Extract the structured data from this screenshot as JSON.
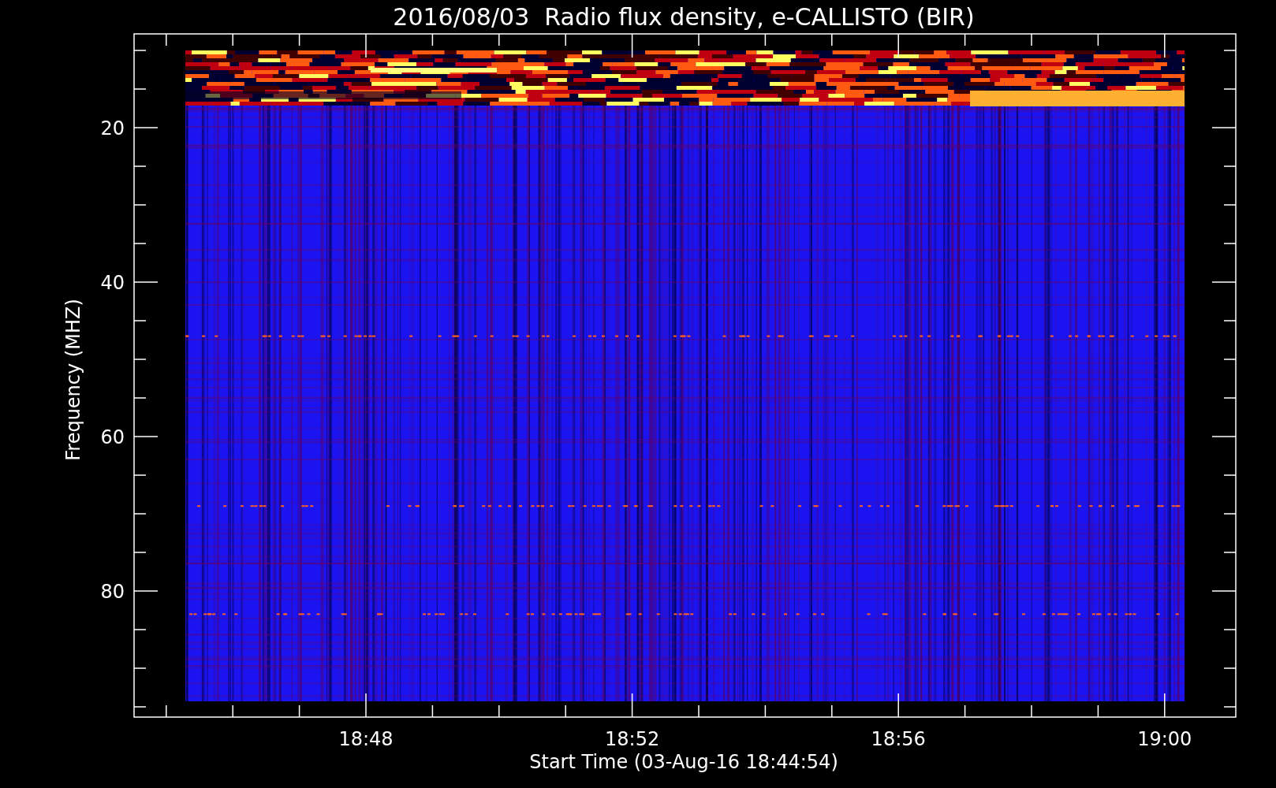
{
  "title": "2016/08/03  Radio flux density, e-CALLISTO (BIR)",
  "y_axis": {
    "label": "Frequency (MHZ)",
    "ticks": [
      "20",
      "40",
      "60",
      "80"
    ]
  },
  "x_axis": {
    "label": "Start Time (03-Aug-16 18:44:54)",
    "ticks": [
      "18:48",
      "18:52",
      "18:56",
      "19:00"
    ]
  }
}
